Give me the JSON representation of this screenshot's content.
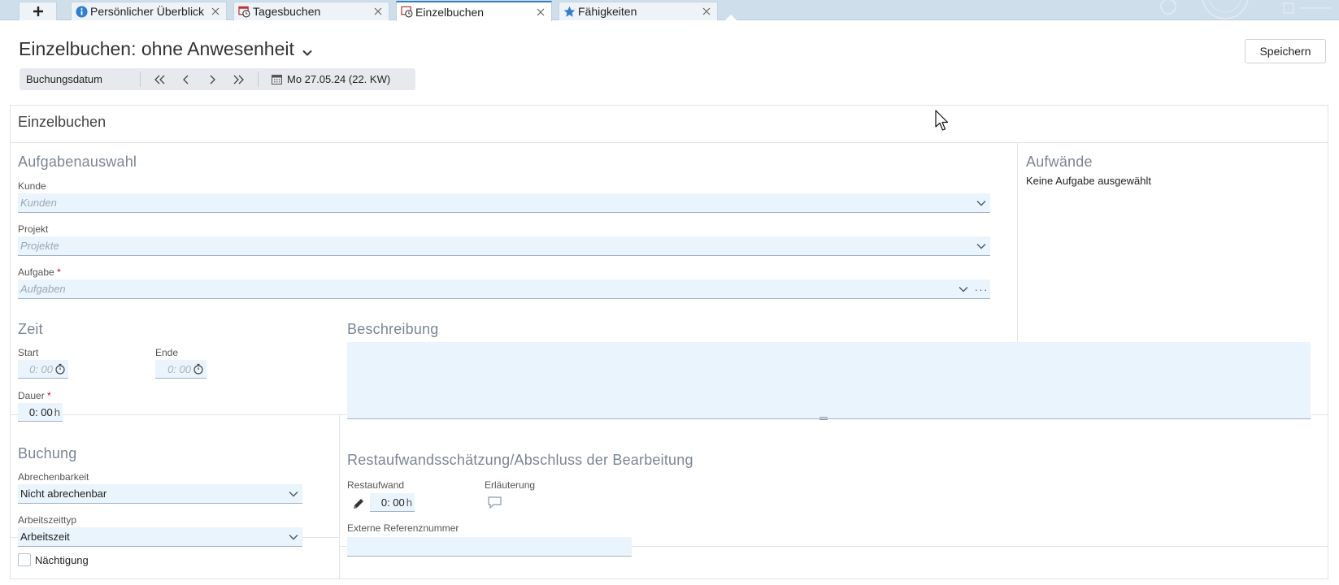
{
  "tabs": [
    {
      "label": "Persönlicher Überblick",
      "icon": "info-icon",
      "active": false
    },
    {
      "label": "Tagesbuchen",
      "icon": "clock-calendar-icon",
      "active": false
    },
    {
      "label": "Einzelbuchen",
      "icon": "clock-icon",
      "active": true
    },
    {
      "label": "Fähigkeiten",
      "icon": "star-icon",
      "active": false
    }
  ],
  "header": {
    "title": "Einzelbuchen: ohne Anwesenheit",
    "save_label": "Speichern"
  },
  "datebar": {
    "label": "Buchungsdatum",
    "date": "Mo 27.05.24 (22. KW)"
  },
  "panel": {
    "title": "Einzelbuchen",
    "task_selection": {
      "title": "Aufgabenauswahl",
      "customer_label": "Kunde",
      "customer_placeholder": "Kunden",
      "project_label": "Projekt",
      "project_placeholder": "Projekte",
      "task_label": "Aufgabe",
      "task_required": "*",
      "task_placeholder": "Aufgaben"
    },
    "efforts": {
      "title": "Aufwände",
      "text": "Keine Aufgabe ausgewählt"
    },
    "time": {
      "title": "Zeit",
      "start_label": "Start",
      "start_value": "0: 00",
      "end_label": "Ende",
      "end_value": "0: 00",
      "duration_label": "Dauer",
      "duration_required": "*",
      "duration_value": "0: 00",
      "duration_unit": "h"
    },
    "description": {
      "title": "Beschreibung"
    },
    "booking": {
      "title": "Buchung",
      "billing_label": "Abrechenbarkeit",
      "billing_value": "Nicht abrechenbar",
      "worktime_label": "Arbeitszeittyp",
      "worktime_value": "Arbeitszeit",
      "overnight_label": "Nächtigung",
      "overnight_checked": false
    },
    "remaining": {
      "title": "Restaufwandsschätzung/Abschluss der Bearbeitung",
      "remaining_label": "Restaufwand",
      "remaining_value": "0: 00",
      "remaining_unit": "h",
      "explanation_label": "Erläuterung",
      "external_ref_label": "Externe Referenznummer",
      "external_ref_value": ""
    }
  },
  "colors": {
    "accent": "#2f7fc4",
    "tabbar": "#cfdeeb",
    "input_bg": "#eaf4fc",
    "section_title": "#7a8694",
    "required": "#d0021b"
  }
}
